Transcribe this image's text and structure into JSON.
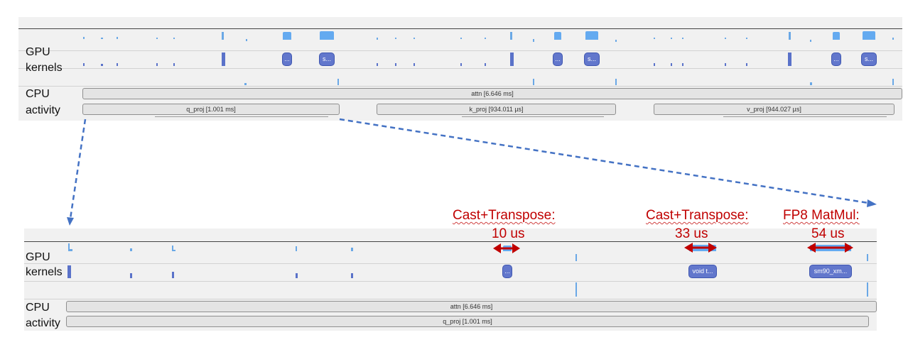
{
  "top": {
    "gpu_label_line1": "GPU",
    "gpu_label_line2": "kernels",
    "cpu_label_line1": "CPU",
    "cpu_label_line2": "activity",
    "attn_bar": "attn [6.646 ms]",
    "q_proj_bar": "q_proj [1.001 ms]",
    "k_proj_bar": "k_proj [934.011 µs]",
    "v_proj_bar": "v_proj [944.027 µs]",
    "kernel_pills": [
      "...",
      "s...",
      "...",
      "s...",
      "...",
      "s..."
    ]
  },
  "bottom": {
    "gpu_label_line1": "GPU",
    "gpu_label_line2": "kernels",
    "cpu_label_line1": "CPU",
    "cpu_label_line2": "activity",
    "attn_bar": "attn [6.646 ms]",
    "q_proj_bar": "q_proj [1.001 ms]",
    "kernel_pills": [
      "...",
      "void t...",
      "sm90_xm..."
    ]
  },
  "annotations": [
    {
      "title": "Cast+Transpose:",
      "value": "10 us"
    },
    {
      "title": "Cast+Transpose:",
      "value": "33 us"
    },
    {
      "title": "FP8 MatMul:",
      "value": "54 us"
    }
  ],
  "colors": {
    "annotation": "#c00000",
    "kernel_pill": "#6277cc",
    "kernel_tick": "#6aa8e6",
    "zoom_arrow": "#4472c4",
    "panel_bg": "#f1f1f1"
  }
}
